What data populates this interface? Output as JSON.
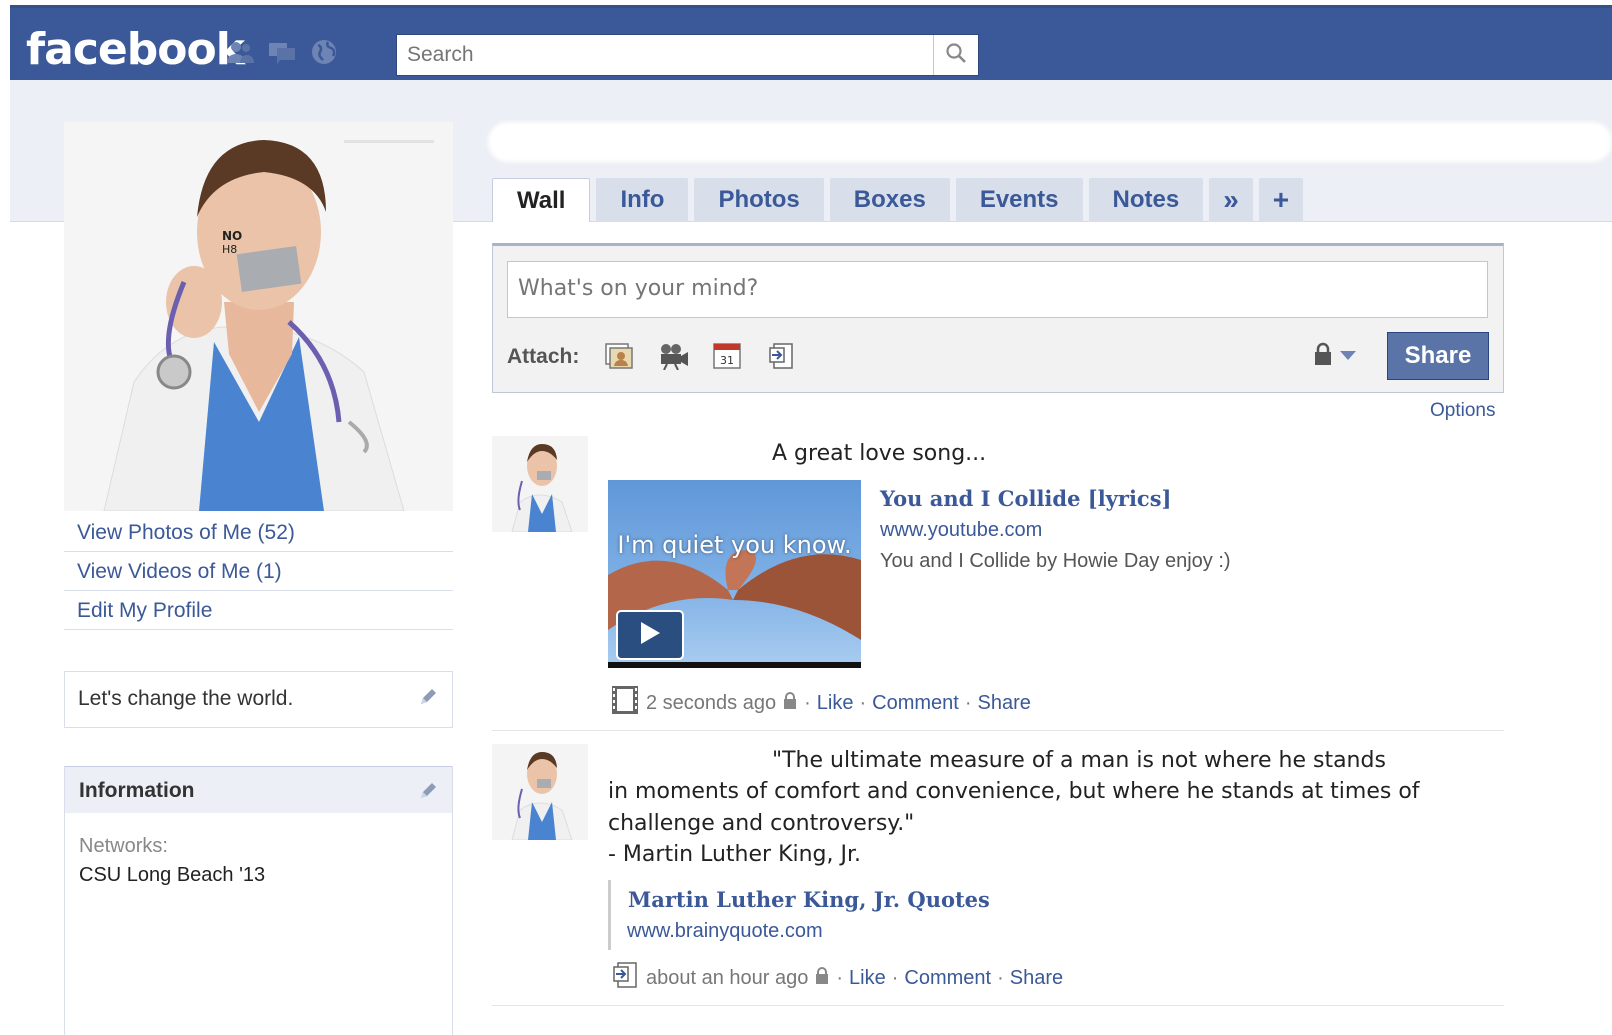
{
  "app": {
    "logo": "facebook",
    "search_placeholder": "Search"
  },
  "tabs": [
    {
      "label": "Wall",
      "active": true
    },
    {
      "label": "Info"
    },
    {
      "label": "Photos"
    },
    {
      "label": "Boxes"
    },
    {
      "label": "Events"
    },
    {
      "label": "Notes"
    },
    {
      "label": "»"
    },
    {
      "label": "+"
    }
  ],
  "sidebar": {
    "links": [
      "View Photos of Me (52)",
      "View Videos of Me (1)",
      "Edit My Profile"
    ],
    "status": "Let's change the world.",
    "info_header": "Information",
    "networks_label": "Networks:",
    "networks_value": "CSU Long Beach '13"
  },
  "composer": {
    "placeholder": "What's on your mind?",
    "attach_label": "Attach:",
    "share_label": "Share",
    "options_label": "Options"
  },
  "stories": [
    {
      "text": "A great love song...",
      "attachment_title": "You and I Collide [lyrics]",
      "attachment_source": "www.youtube.com",
      "attachment_desc": "You and I Collide by Howie Day enjoy :)",
      "video_caption": "I'm quiet you know.",
      "time": "2 seconds ago",
      "actions": [
        "Like",
        "Comment",
        "Share"
      ]
    },
    {
      "text_line1": "\"The ultimate measure of a man is not where he stands",
      "text_line2": "in moments of comfort and convenience, but where he stands at times of",
      "text_line3": "challenge and controversy.\"",
      "text_line4": "- Martin Luther King, Jr.",
      "attachment_title": "Martin Luther King, Jr. Quotes",
      "attachment_source": "www.brainyquote.com",
      "time": "about an hour ago",
      "actions": [
        "Like",
        "Comment",
        "Share"
      ]
    }
  ],
  "colors": {
    "brand": "#3b5998",
    "tab_bg": "#d8dfea",
    "band": "#eceff5"
  }
}
